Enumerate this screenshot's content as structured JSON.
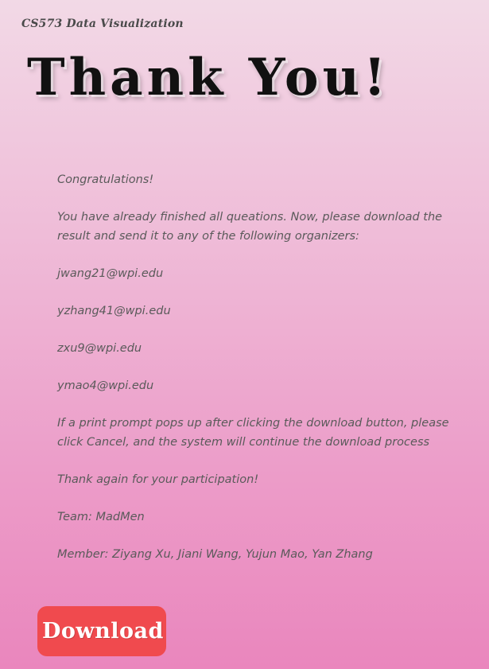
{
  "header": {
    "course_title": "CS573 Data Visualization",
    "heading": "Thank You!"
  },
  "message": {
    "congrats": "Congratulations!",
    "instructions": "You have already finished all queations. Now, please download the result and send it to any of the following organizers:",
    "emails": [
      "jwang21@wpi.edu",
      "yzhang41@wpi.edu",
      "zxu9@wpi.edu",
      "ymao4@wpi.edu"
    ],
    "print_note": "If a print prompt pops up after clicking the download button, please click Cancel, and the system will continue the download process",
    "thanks": "Thank again for your participation!",
    "team": "Team: MadMen",
    "members": "Member: Ziyang Xu, Jiani Wang, Yujun Mao, Yan Zhang"
  },
  "actions": {
    "download_label": "Download"
  },
  "colors": {
    "download_button": "#f04a4e",
    "background_top": "#f2d9e6",
    "background_bottom": "#ea86bd"
  }
}
